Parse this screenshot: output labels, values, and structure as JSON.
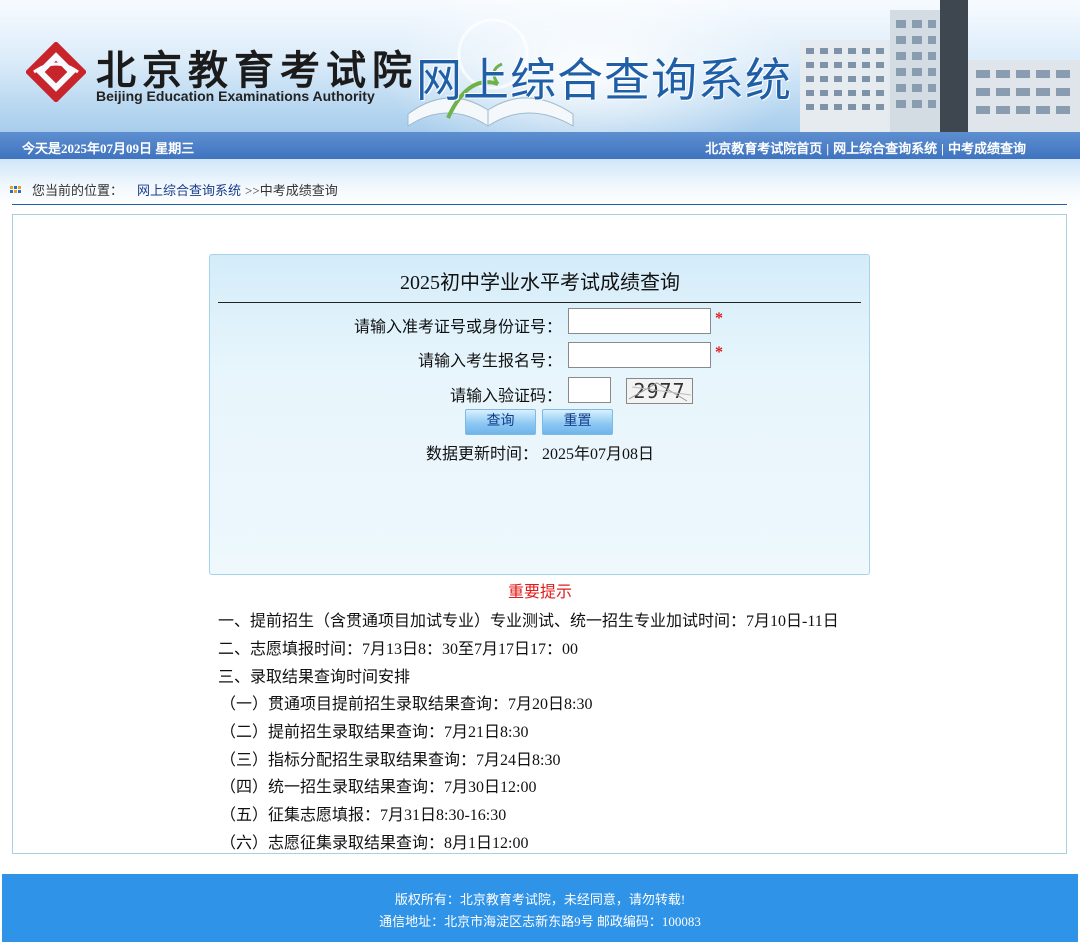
{
  "header": {
    "logo_cn": "北京教育考试院",
    "logo_en": "Beijing Education Examinations Authority",
    "system_title": "网上综合查询系统",
    "logo_color": "#c8242b",
    "title_color": "#1e5fa8"
  },
  "topbar": {
    "date_text": "今天是2025年07月09日 星期三",
    "links": [
      "北京教育考试院首页",
      "网上综合查询系统",
      "中考成绩查询"
    ],
    "separator": "|"
  },
  "breadcrumb": {
    "prefix": "您当前的位置：",
    "link": "网上综合查询系统",
    "current": ">>中考成绩查询"
  },
  "query_form": {
    "title": "2025初中学业水平考试成绩查询",
    "fields": [
      {
        "label": "请输入准考证号或身份证号：",
        "value": "",
        "required_mark": "*"
      },
      {
        "label": "请输入考生报名号：",
        "value": "",
        "required_mark": "*"
      },
      {
        "label": "请输入验证码：",
        "value": ""
      }
    ],
    "captcha_text": "2977",
    "buttons": {
      "query": "查询",
      "reset": "重置"
    },
    "update_time": "数据更新时间： 2025年07月08日"
  },
  "notice": {
    "title": "重要提示",
    "lines": [
      "一、提前招生（含贯通项目加试专业）专业测试、统一招生专业加试时间：7月10日-11日",
      "二、志愿填报时间：7月13日8：30至7月17日17：00",
      "三、录取结果查询时间安排",
      "（一）贯通项目提前招生录取结果查询：7月20日8:30",
      "（二）提前招生录取结果查询：7月21日8:30",
      "（三）指标分配招生录取结果查询：7月24日8:30",
      "（四）统一招生录取结果查询：7月30日12:00",
      "（五）征集志愿填报：7月31日8:30-16:30",
      "（六）志愿征集录取结果查询：8月1日12:00"
    ]
  },
  "footer": {
    "copyright": "版权所有：北京教育考试院，未经同意，请勿转载!",
    "address": "通信地址：北京市海淀区志新东路9号 邮政编码：100083",
    "background": "#2f93e8"
  }
}
